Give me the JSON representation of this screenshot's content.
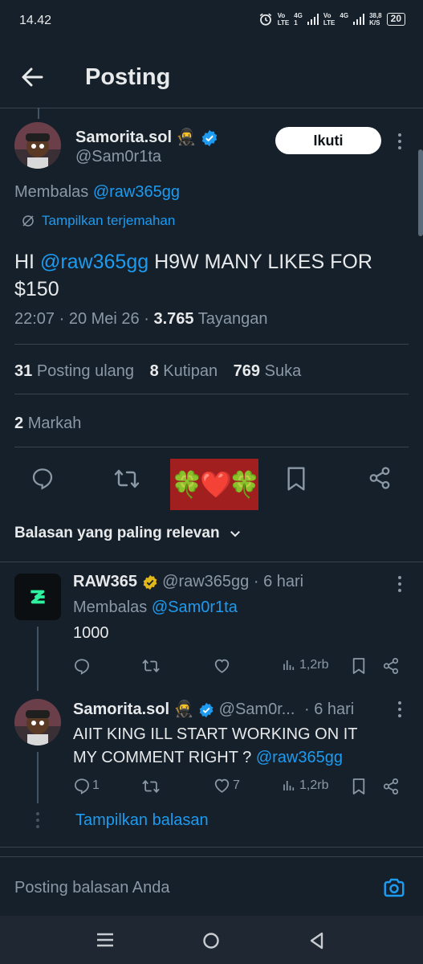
{
  "status_bar": {
    "time": "14.42",
    "net_label_1_top": "Vo",
    "net_label_1_bottom": "LTE",
    "net_label_2_top": "4G",
    "net_label_2_bottom": "1",
    "net_label_3_top": "Vo",
    "net_label_3_bottom": "LTE",
    "net_label_4_top": "4G",
    "speed_top": "38,8",
    "speed_bottom": "K/S",
    "battery": "20"
  },
  "header": {
    "title": "Posting"
  },
  "post": {
    "author_name": "Samorita.sol",
    "author_emoji": "🥷",
    "author_handle": "@Sam0r1ta",
    "follow_label": "Ikuti",
    "replying_prefix": "Membalas",
    "replying_to": "@raw365gg",
    "translate_label": "Tampilkan terjemahan",
    "text_prefix": "HI",
    "text_mention": "@raw365gg",
    "text_rest": "H9W MANY LIKES FOR",
    "text_line2": "$150",
    "time": "22:07",
    "date": "20 Mei 26",
    "views_count": "3.765",
    "views_label": "Tayangan",
    "reposts_count": "31",
    "reposts_label": "Posting ulang",
    "quotes_count": "8",
    "quotes_label": "Kutipan",
    "likes_count": "769",
    "likes_label": "Suka",
    "bookmarks_count": "2",
    "bookmarks_label": "Markah",
    "like_button_emoji": "🍀❤️🍀"
  },
  "sort": {
    "label": "Balasan yang paling relevan"
  },
  "replies": [
    {
      "name": "RAW365",
      "handle": "@raw365gg",
      "time": "· 6 hari",
      "replying_prefix": "Membalas",
      "replying_to": "@Sam0r1ta",
      "text": "1000",
      "views": "1,2rb",
      "reply_count": "",
      "like_count": ""
    },
    {
      "name": "Samorita.sol",
      "emoji": "🥷",
      "handle": "@Sam0r...",
      "time": "· 6 hari",
      "text_line1": "AIIT KING ILL START WORKING ON IT",
      "text_line2": "MY COMMENT RIGHT ?",
      "text_mention": "@raw365gg",
      "views": "1,2rb",
      "reply_count": "1",
      "like_count": "7"
    }
  ],
  "show_replies_label": "Tampilkan balasan",
  "composer": {
    "placeholder": "Posting balasan Anda"
  },
  "colors": {
    "background": "#15202b",
    "accent": "#1d9bf0",
    "muted": "#8b98a5",
    "gold_badge": "#e2b719"
  }
}
